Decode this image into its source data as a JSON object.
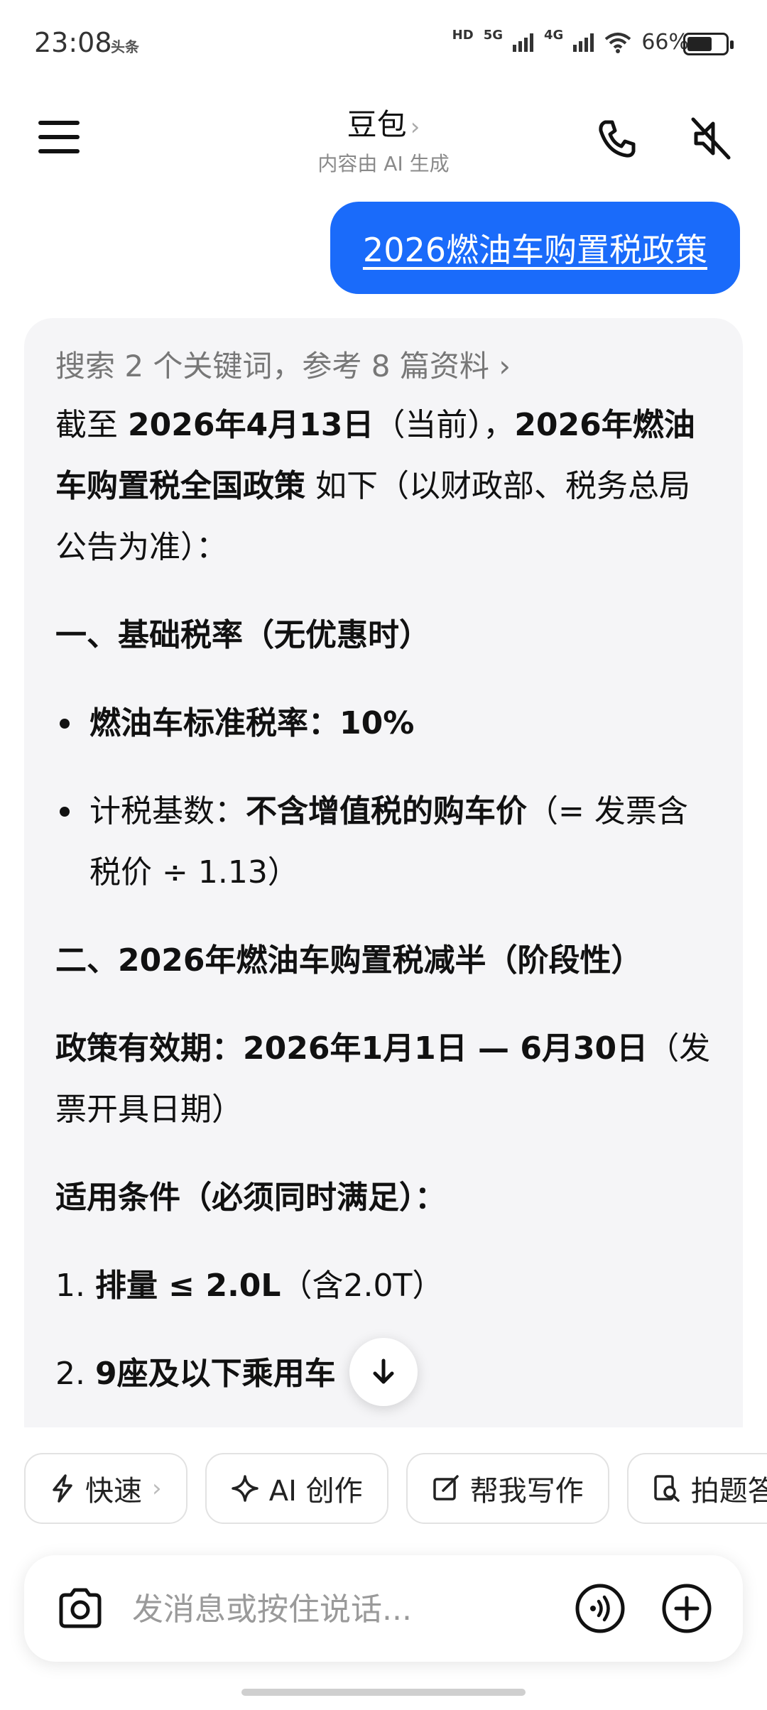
{
  "status_bar": {
    "time": "23:08",
    "app_badge": "头条",
    "hd_label": "HD",
    "net_5g": "5G",
    "net_4g": "4G",
    "battery_pct": "66%",
    "battery_level": 0.66
  },
  "header": {
    "title": "豆包",
    "title_chevron": "›",
    "subtitle": "内容由 AI 生成",
    "icons": [
      "menu-icon",
      "phone-icon",
      "mute-icon"
    ]
  },
  "user_message": "2026燃油车购置税政策",
  "answer": {
    "search_line": "搜索 2 个关键词，参考 8 篇资料 ›",
    "intro": {
      "t1": "截至 ",
      "b1": "2026年4月13日",
      "t2": "（当前），",
      "b2": "2026年燃油车购置税全国政策",
      "t3": " 如下（以财政部、税务总局公告为准）："
    },
    "section1": "一、基础税率（无优惠时）",
    "bullet1": "燃油车标准税率：10%",
    "bullet2": {
      "t1": "计税基数：",
      "b1": "不含增值税的购车价",
      "t2": "（= 发票含税价 ÷ 1.13）"
    },
    "section2": "二、2026年燃油车购置税减半（阶段性）",
    "validity": {
      "b1": "政策有效期：2026年1月1日 — 6月30日",
      "t1": "（发票开具日期）"
    },
    "conditions_title": "适用条件（必须同时满足）：",
    "cond1": {
      "num": "1. ",
      "b1": "排量 ≤ 2.0L",
      "t1": "（含2.0T）"
    },
    "cond2": {
      "num": "2. ",
      "b1": "9座及以下乘用车"
    }
  },
  "chips": [
    "快速",
    "AI 创作",
    "帮我写作",
    "拍题答疑"
  ],
  "chip_chevron": "›",
  "input": {
    "placeholder": "发消息或按住说话..."
  }
}
